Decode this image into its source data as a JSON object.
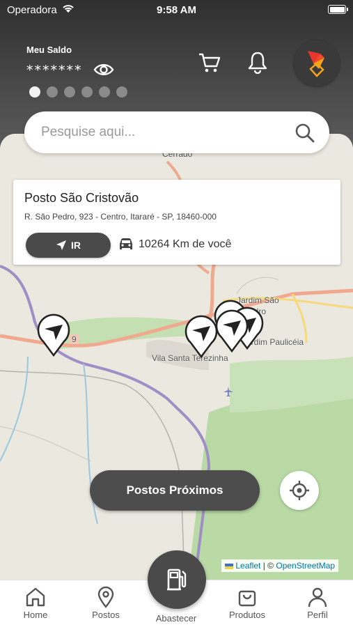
{
  "status_bar": {
    "carrier": "Operadora",
    "time": "9:58 AM"
  },
  "header": {
    "balance_label": "Meu Saldo",
    "balance_value": "*******",
    "carousel_dots": 6,
    "carousel_active_index": 0
  },
  "search": {
    "placeholder": "Pesquise aqui..."
  },
  "station_card": {
    "name": "Posto São Cristovão",
    "address": "R. São Pedro, 923 - Centro, Itararé - SP, 18460-000",
    "go_label": "IR",
    "distance": "10264 Km de você"
  },
  "map": {
    "labels": {
      "cerrado": "Cerrado",
      "jardim_sao_pedro_1": "Jardim São",
      "jardim_sao_pedro_2": "Pedro",
      "paulicea": "Jardim Paulicéia",
      "vila": "Vila Santa Terezinha",
      "road": "9"
    },
    "attribution": {
      "leaflet": "Leaflet",
      "separator": "| ©",
      "osm": "OpenStreetMap"
    }
  },
  "buttons": {
    "nearby": "Postos Próximos"
  },
  "tabbar": {
    "home": "Home",
    "postos": "Postos",
    "abastecer": "Abastecer",
    "produtos": "Produtos",
    "perfil": "Perfil"
  },
  "colors": {
    "dark": "#4a4a4a",
    "accent_red": "#e8362b",
    "accent_orange": "#f5a31a",
    "map_green": "#b9d9a5"
  }
}
